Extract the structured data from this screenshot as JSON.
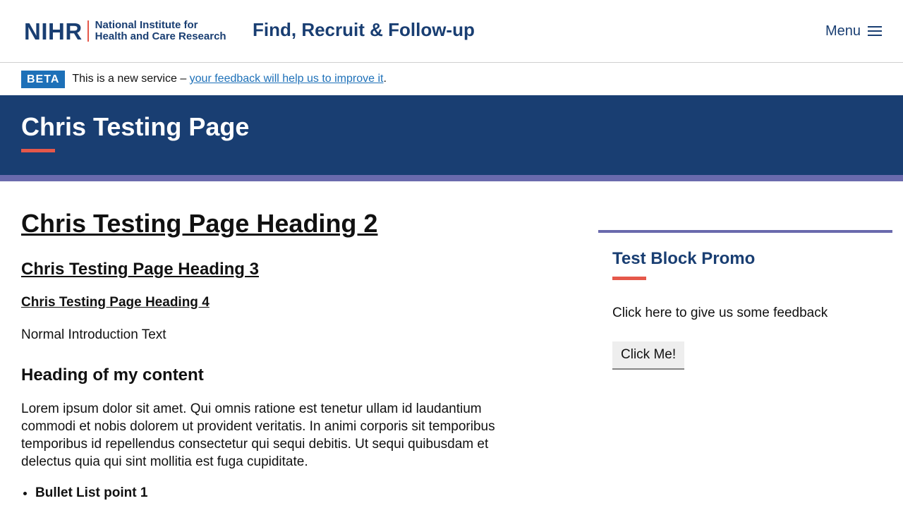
{
  "header": {
    "logo_mark": "NIHR",
    "logo_line1": "National Institute for",
    "logo_line2": "Health and Care Research",
    "service_name": "Find, Recruit & Follow-up",
    "menu_label": "Menu"
  },
  "beta": {
    "tag": "BETA",
    "text_before": "This is a new service – ",
    "link_text": "your feedback will help us to improve it",
    "text_after": "."
  },
  "hero": {
    "title": "Chris Testing Page"
  },
  "main": {
    "heading2": "Chris Testing Page Heading 2",
    "heading3": "Chris Testing Page Heading 3",
    "heading4": "Chris Testing Page Heading 4",
    "intro": "Normal Introduction Text",
    "content_heading": "Heading of my content",
    "paragraph": "Lorem ipsum dolor sit amet. Qui omnis ratione est tenetur ullam id laudantium commodi et nobis dolorem ut provident veritatis. In animi corporis sit temporibus temporibus id repellendus consectetur qui sequi debitis. Ut sequi quibusdam et delectus quia qui sint mollitia est fuga cupiditate.",
    "bullets": [
      "Bullet List point 1"
    ]
  },
  "promo": {
    "title": "Test Block Promo",
    "text": "Click here to give us some feedback",
    "button_label": "Click Me!"
  },
  "colors": {
    "brand_navy": "#193e72",
    "accent_coral": "#e5584a",
    "stripe_purple": "#6a6aad",
    "link_blue": "#1d70b8"
  }
}
